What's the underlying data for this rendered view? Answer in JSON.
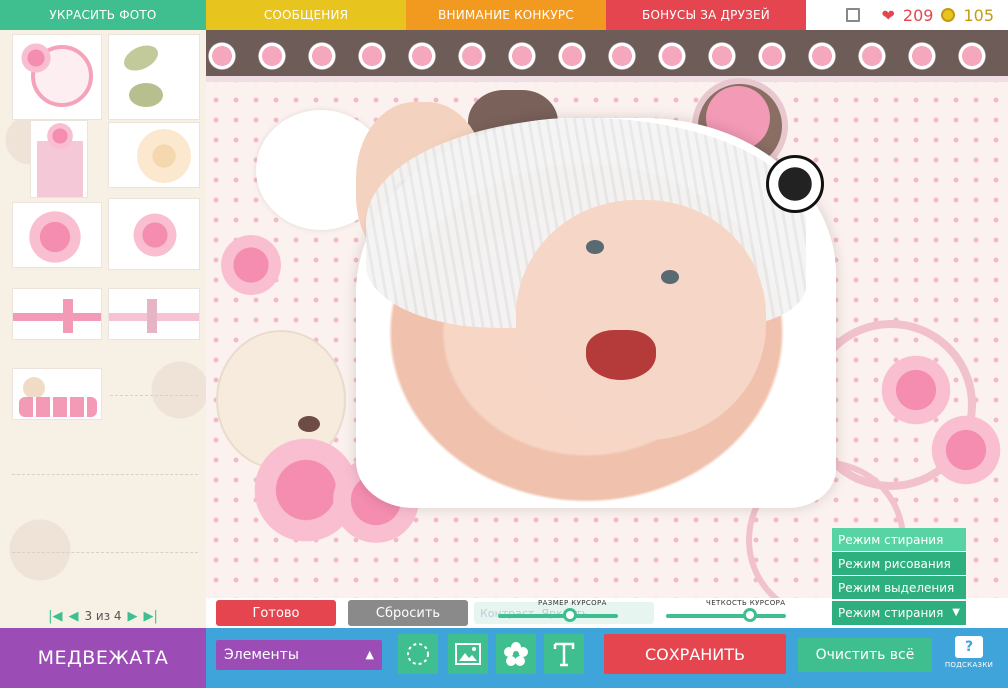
{
  "nav": {
    "tabs": [
      {
        "label": "УКРАСИТЬ ФОТО"
      },
      {
        "label": "СООБЩЕНИЯ"
      },
      {
        "label": "ВНИМАНИЕ КОНКУРС"
      },
      {
        "label": "БОНУСЫ ЗА ДРУЗЕЙ"
      }
    ],
    "hearts": "209",
    "coins": "105"
  },
  "pager": {
    "text": "3 из 4"
  },
  "controls": {
    "ready_label": "Готово",
    "reset_label": "Сбросить",
    "faint_label": "Контраст",
    "faint_label2": "Яркость",
    "cursor_size_label": "РАЗМЕР КУРСОРА",
    "cursor_size_value": 0.6,
    "cursor_sharpness_label": "ЧЕТКОСТЬ КУРСОРА",
    "cursor_sharpness_value": 0.7
  },
  "mode": {
    "options": [
      "Режим стирания",
      "Режим рисования",
      "Режим выделения"
    ],
    "selected": "Режим стирания"
  },
  "bottom": {
    "category_title": "МЕДВЕЖАТА",
    "select_value": "Элементы",
    "save_label": "СОХРАНИТЬ",
    "clear_label": "Очистить всё",
    "help_label": "ПОДСКАЗКИ",
    "help_glyph": "?"
  },
  "colors": {
    "green": "#3fbf8f",
    "red": "#e5454f",
    "purple": "#9b4db5",
    "blue": "#3fa4d9",
    "yellow": "#e8c41f",
    "orange": "#f29a1f"
  },
  "icons": [
    "fullscreen-icon",
    "heart-icon",
    "coin-icon",
    "first-page-icon",
    "prev-page-icon",
    "next-page-icon",
    "last-page-icon",
    "lasso-icon",
    "image-icon",
    "flower-icon",
    "text-icon",
    "help-icon"
  ]
}
